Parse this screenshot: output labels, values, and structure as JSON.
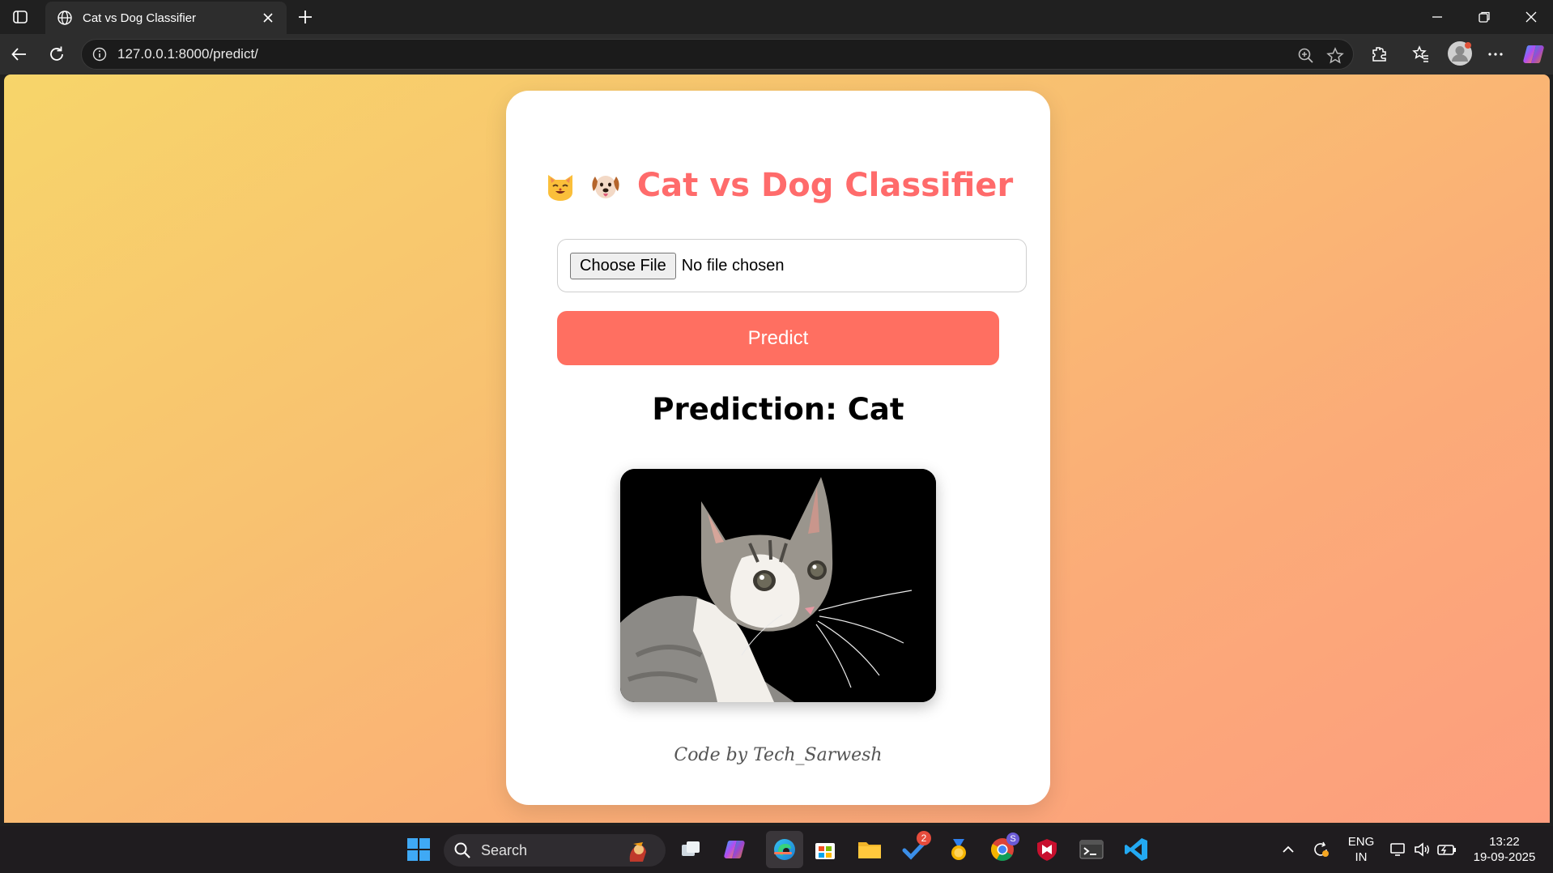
{
  "browser": {
    "tab_title": "Cat vs Dog Classifier",
    "url": "127.0.0.1:8000/predict/"
  },
  "page": {
    "title": "Cat vs Dog Classifier",
    "title_emojis": [
      "cat-face",
      "dog-face"
    ],
    "file_input": {
      "button_label": "Choose File",
      "status": "No file chosen"
    },
    "predict_button": "Predict",
    "prediction_text": "Prediction: Cat",
    "image_subject": "cat",
    "footer": "Code by Tech_Sarwesh"
  },
  "colors": {
    "accent": "#ff6b6b",
    "predict_button": "#ff6f61",
    "gradient_start": "#f7d56a",
    "gradient_end": "#fd9d7e"
  },
  "taskbar": {
    "search_placeholder": "Search",
    "todo_badge": "2",
    "chrome_badge": "S",
    "language": "ENG",
    "region": "IN",
    "time": "13:22",
    "date": "19-09-2025"
  }
}
